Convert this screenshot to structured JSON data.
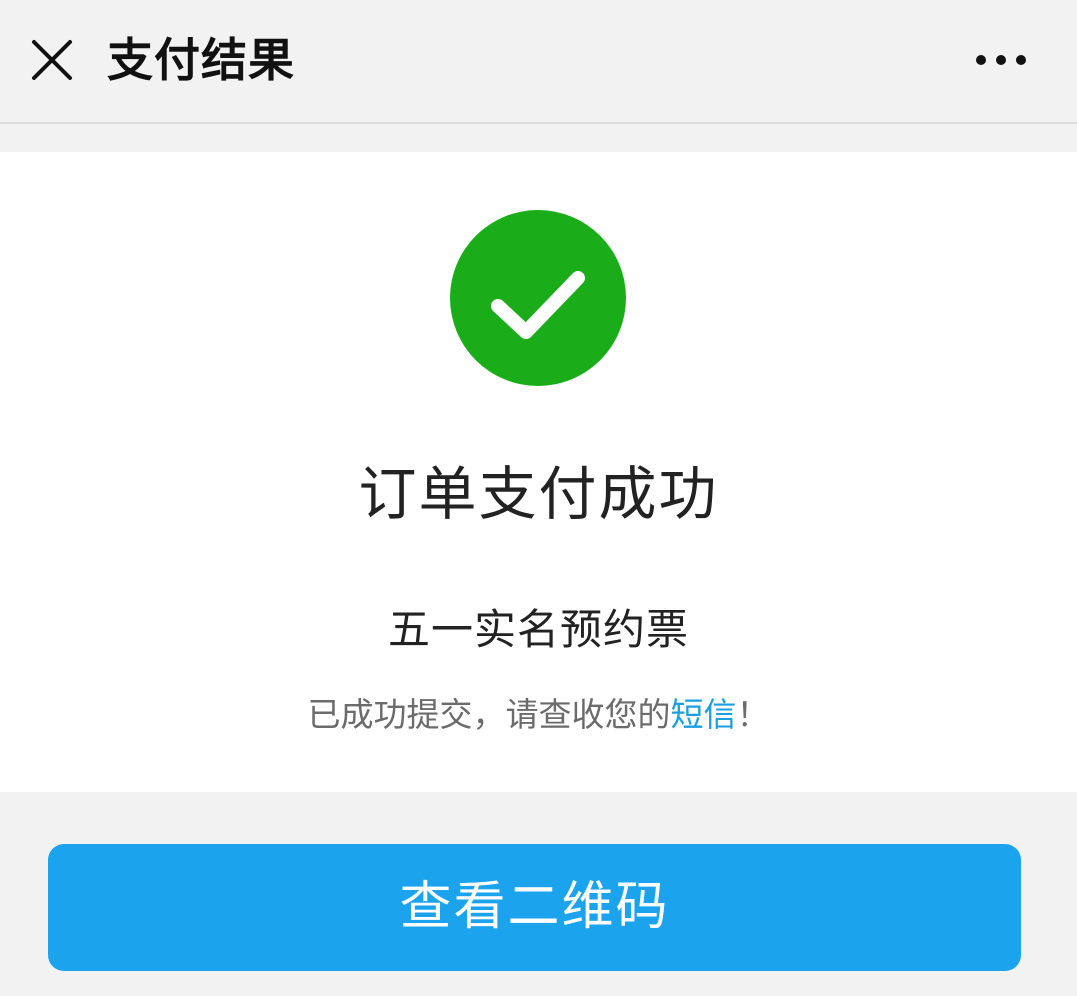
{
  "header": {
    "title": "支付结果",
    "close_icon": "close-icon",
    "more_icon": "more-dots-icon"
  },
  "result": {
    "icon": "check-circle-icon",
    "icon_color": "#1aad19",
    "title": "订单支付成功",
    "ticket_name": "五一实名预约票",
    "notice_prefix": "已成功提交，请查收您的",
    "notice_link": "短信",
    "notice_suffix": "！",
    "link_color": "#1a9fe0"
  },
  "actions": {
    "view_qr_label": "查看二维码",
    "button_color": "#1ba3ee"
  }
}
